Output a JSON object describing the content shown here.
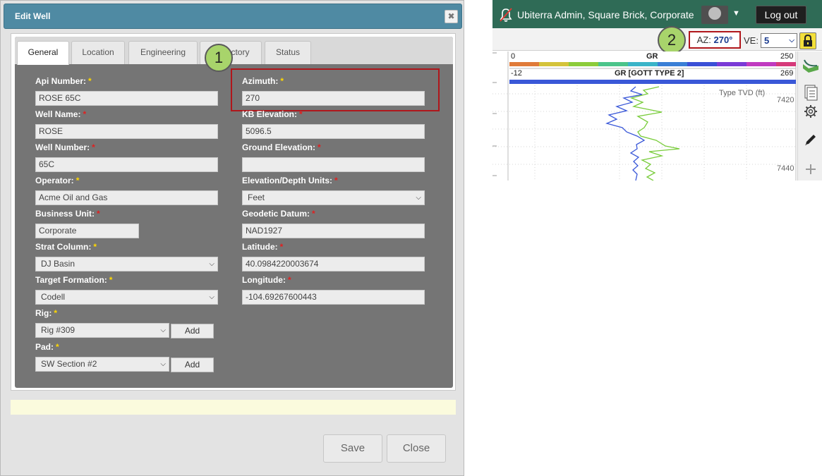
{
  "dialog": {
    "title": "Edit Well",
    "close_glyph": "✖",
    "tabs": [
      "General",
      "Location",
      "Engineering",
      "Trajectory",
      "Status"
    ],
    "active_tab": "General",
    "required_mark": "*",
    "fields": {
      "api_number": {
        "label": "Api Number:",
        "value": "ROSE 65C"
      },
      "well_name": {
        "label": "Well Name:",
        "value": "ROSE"
      },
      "well_number": {
        "label": "Well Number:",
        "value": "65C"
      },
      "operator": {
        "label": "Operator:",
        "value": "Acme Oil and Gas"
      },
      "business_unit": {
        "label": "Business Unit:",
        "value": "Corporate"
      },
      "strat_column": {
        "label": "Strat Column:",
        "value": "DJ Basin"
      },
      "target_formation": {
        "label": "Target Formation:",
        "value": "Codell"
      },
      "rig": {
        "label": "Rig:",
        "value": "Rig #309"
      },
      "pad": {
        "label": "Pad:",
        "value": "SW Section #2"
      },
      "azimuth": {
        "label": "Azimuth:",
        "value": "270"
      },
      "kb_elevation": {
        "label": "KB Elevation:",
        "value": "5096.5"
      },
      "ground_elevation": {
        "label": "Ground Elevation:",
        "value": ""
      },
      "elevation_depth_units": {
        "label": "Elevation/Depth Units:",
        "value": "Feet"
      },
      "geodetic_datum": {
        "label": "Geodetic Datum:",
        "value": "NAD1927"
      },
      "latitude": {
        "label": "Latitude:",
        "value": "40.0984220003674"
      },
      "longitude": {
        "label": "Longitude:",
        "value": "-104.69267600443"
      }
    },
    "add_label": "Add",
    "save_label": "Save",
    "close_label": "Close",
    "callout_1": "1"
  },
  "app": {
    "user_text": "Ubiterra Admin, Square Brick, Corporate",
    "logout_label": "Log out",
    "az_label": "AZ:",
    "az_value": "270°",
    "ve_label": "VE:",
    "ve_value": "5",
    "callout_2": "2",
    "tracks": [
      {
        "min": "0",
        "name": "GR",
        "max": "250"
      },
      {
        "min": "-12",
        "name": "GR [GOTT TYPE 2]",
        "max": "269"
      }
    ],
    "type_tvd_label": "Type TVD (ft)",
    "depth_ticks": [
      "7420",
      "7440"
    ],
    "colors": {
      "header_green": "#2f6b56",
      "highlight_red": "#b0161b",
      "callout_green": "#a8d46b",
      "curve_blue": "#3a58d8",
      "curve_green": "#79cc3b"
    }
  }
}
